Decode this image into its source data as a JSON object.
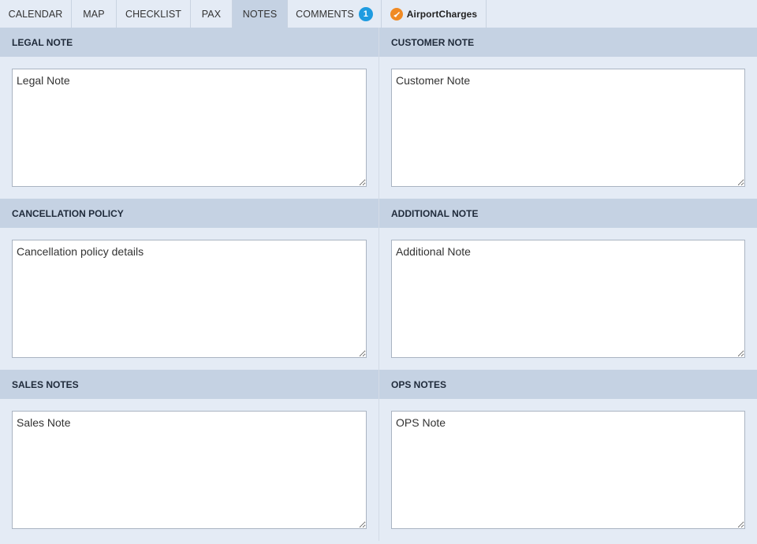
{
  "tabs": [
    {
      "label": "CALENDAR"
    },
    {
      "label": "MAP"
    },
    {
      "label": "CHECKLIST"
    },
    {
      "label": "PAX"
    },
    {
      "label": "NOTES"
    },
    {
      "label": "COMMENTS",
      "badge": "1"
    },
    {
      "label": "AirportCharges",
      "icon": "airport-charges-logo-icon"
    }
  ],
  "active_tab": "NOTES",
  "colors": {
    "header_bg": "#c5d2e3",
    "page_bg": "#e4ebf5",
    "badge": "#1e9be0",
    "logo": "#f08a24"
  },
  "sections": {
    "legal": {
      "title": "LEGAL NOTE",
      "value": "Legal Note"
    },
    "customer": {
      "title": "CUSTOMER NOTE",
      "value": "Customer Note"
    },
    "cancellation": {
      "title": "CANCELLATION POLICY",
      "value": "Cancellation policy details"
    },
    "additional": {
      "title": "ADDITIONAL NOTE",
      "value": "Additional Note"
    },
    "sales": {
      "title": "SALES NOTES",
      "value": "Sales Note"
    },
    "ops": {
      "title": "OPS NOTES",
      "value": "OPS Note"
    }
  }
}
